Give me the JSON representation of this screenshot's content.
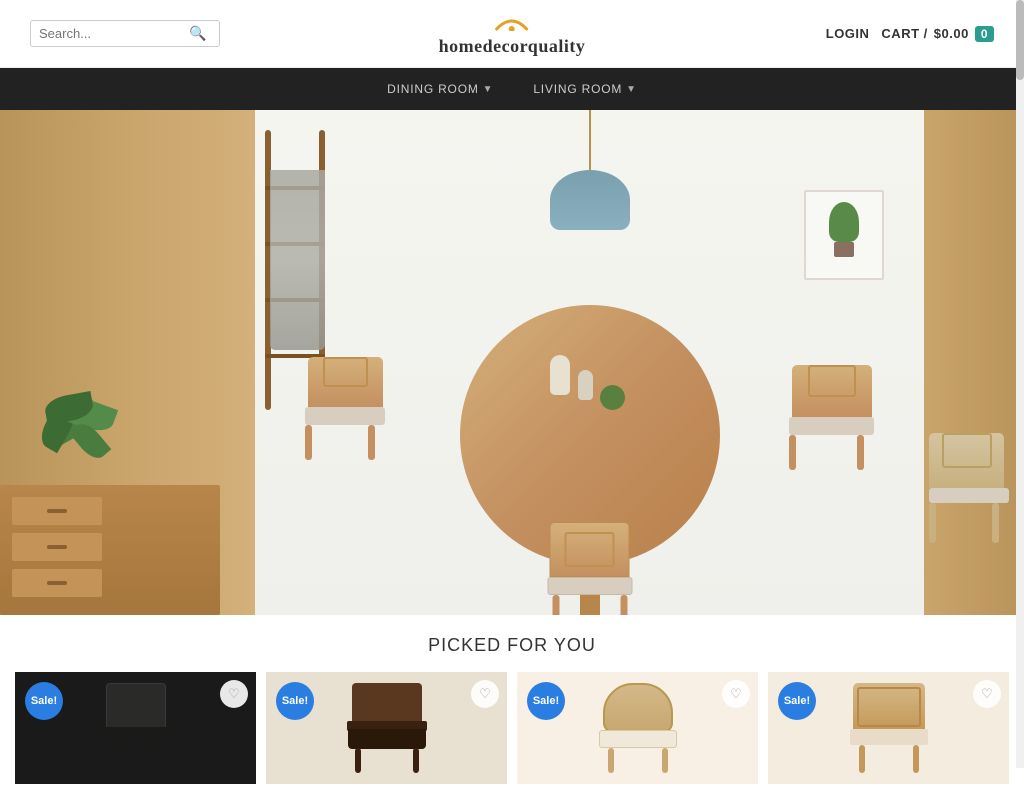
{
  "site": {
    "name": "homedecorquality",
    "logo_icon": "⌒",
    "tagline": "homedecorquality"
  },
  "header": {
    "search_placeholder": "Search...",
    "login_label": "LOGIN",
    "cart_label": "CART /",
    "cart_amount": "$0.00",
    "cart_count": "0"
  },
  "nav": {
    "items": [
      {
        "label": "DINING ROOM",
        "has_dropdown": true
      },
      {
        "label": "LIVING ROOM",
        "has_dropdown": true
      }
    ]
  },
  "hero": {
    "alt": "Dining room furniture hero image"
  },
  "picked_section": {
    "title": "PICKED FOR YOU"
  },
  "products": [
    {
      "id": 1,
      "sale_label": "Sale!",
      "wishlist_icon": "♡",
      "bg_color": "#1a1a1a"
    },
    {
      "id": 2,
      "sale_label": "Sale!",
      "wishlist_icon": "♡",
      "bg_color": "#3a2010"
    },
    {
      "id": 3,
      "sale_label": "Sale!",
      "wishlist_icon": "♡",
      "bg_color": "#d4b080"
    },
    {
      "id": 4,
      "sale_label": "Sale!",
      "wishlist_icon": "♡",
      "bg_color": "#c8b070"
    }
  ],
  "colors": {
    "accent": "#2a7de1",
    "nav_bg": "#222222",
    "nav_text": "#cccccc",
    "teal": "#2a9d8f"
  }
}
